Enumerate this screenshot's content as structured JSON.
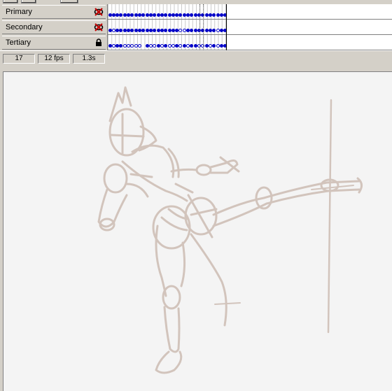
{
  "layers": [
    {
      "name": "Primary",
      "icon": "hidden-eye-icon"
    },
    {
      "name": "Secondary",
      "icon": "hidden-eye-icon"
    },
    {
      "name": "Tertiary",
      "icon": "lock-icon"
    }
  ],
  "status": {
    "current_frame": "17",
    "frame_rate": "12 fps",
    "elapsed_time": "1.3s"
  },
  "colors": {
    "keyframe": "#0000c8",
    "sketch": "#d2c4bc",
    "stage_bg": "#f4f4f4",
    "chrome": "#d4d0c8"
  },
  "frames": {
    "total": 32,
    "playhead": 25,
    "rows": [
      "FFFFFFFFFFFFFFFFFFFFFFFFFFFFFFFF",
      "FHFFFFFFFFFFFFFFFFFHHFFFFFFFFHFF",
      "FHFFHHHHH.FHHFHFHHFHFHFFHHFHFHFF"
    ]
  }
}
